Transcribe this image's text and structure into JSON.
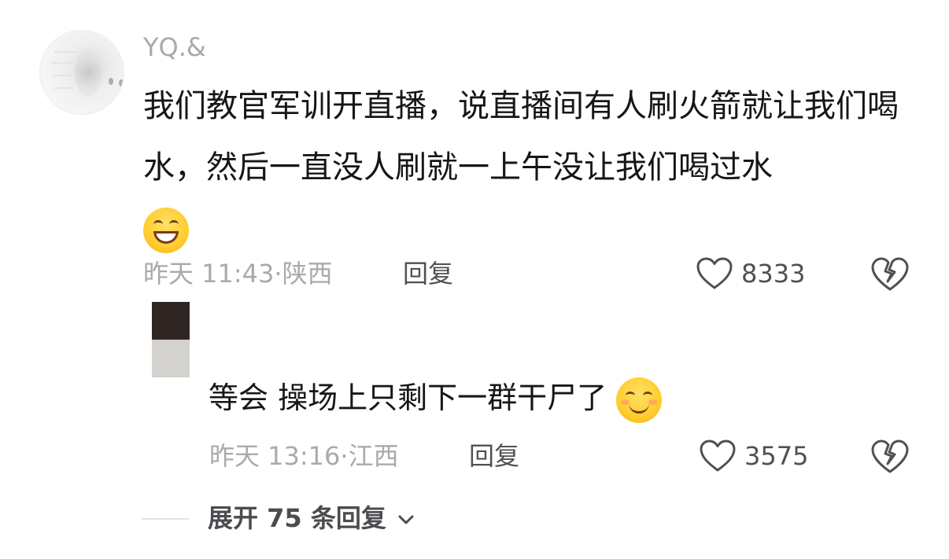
{
  "comment": {
    "username": "YQ.&",
    "text": "我们教官军训开直播，说直播间有人刷火箭就让我们喝水，然后一直没人刷就一上午没让我们喝过水",
    "emoji": "grinning-face",
    "time": "昨天 11:43·",
    "location": "陕西",
    "reply_label": "回复",
    "likes": "8333"
  },
  "reply": {
    "text": "等会 操场上只剩下一群干尸了",
    "emoji": "smiling-face",
    "time": "昨天 13:16·",
    "location": "江西",
    "reply_label": "回复",
    "likes": "3575"
  },
  "expand": {
    "label": "展开 75 条回复"
  },
  "colors": {
    "meta": "#a9a9ae",
    "text": "#161616",
    "action": "#505054"
  }
}
